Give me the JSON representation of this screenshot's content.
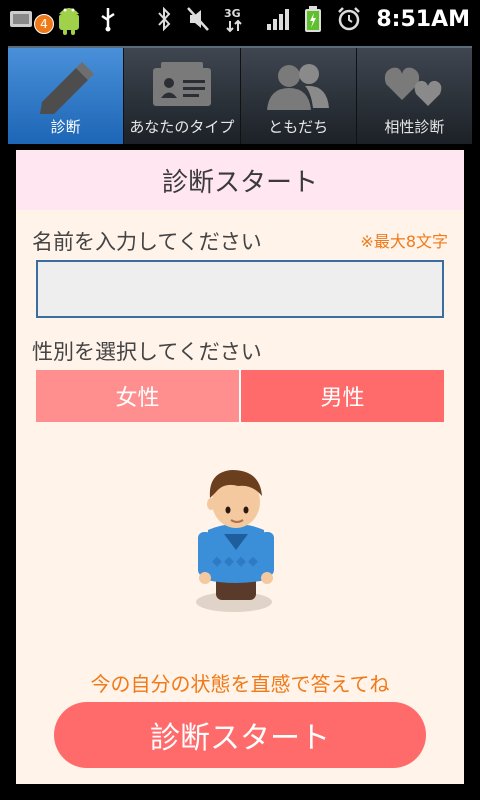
{
  "status_bar": {
    "notification_count": "4",
    "time": "8:51AM"
  },
  "tabs": [
    {
      "label": "診断",
      "icon": "pencil-icon",
      "active": true
    },
    {
      "label": "あなたのタイプ",
      "icon": "id-card-icon",
      "active": false
    },
    {
      "label": "ともだち",
      "icon": "people-icon",
      "active": false
    },
    {
      "label": "相性診断",
      "icon": "hearts-icon",
      "active": false
    }
  ],
  "panel": {
    "title": "診断スタート",
    "name_label": "名前を入力してください",
    "max_note": "※最大8文字",
    "name_value": "",
    "gender_label": "性別を選択してください",
    "gender_female": "女性",
    "gender_male": "男性",
    "hint": "今の自分の状態を直感で答えてね",
    "start_button": "診断スタート"
  },
  "colors": {
    "accent": "#f07a19",
    "button": "#ff6b6b",
    "panel_bg": "#fff3ea",
    "header_bg": "#ffe6f1",
    "tab_active": "#2f7ccc"
  }
}
